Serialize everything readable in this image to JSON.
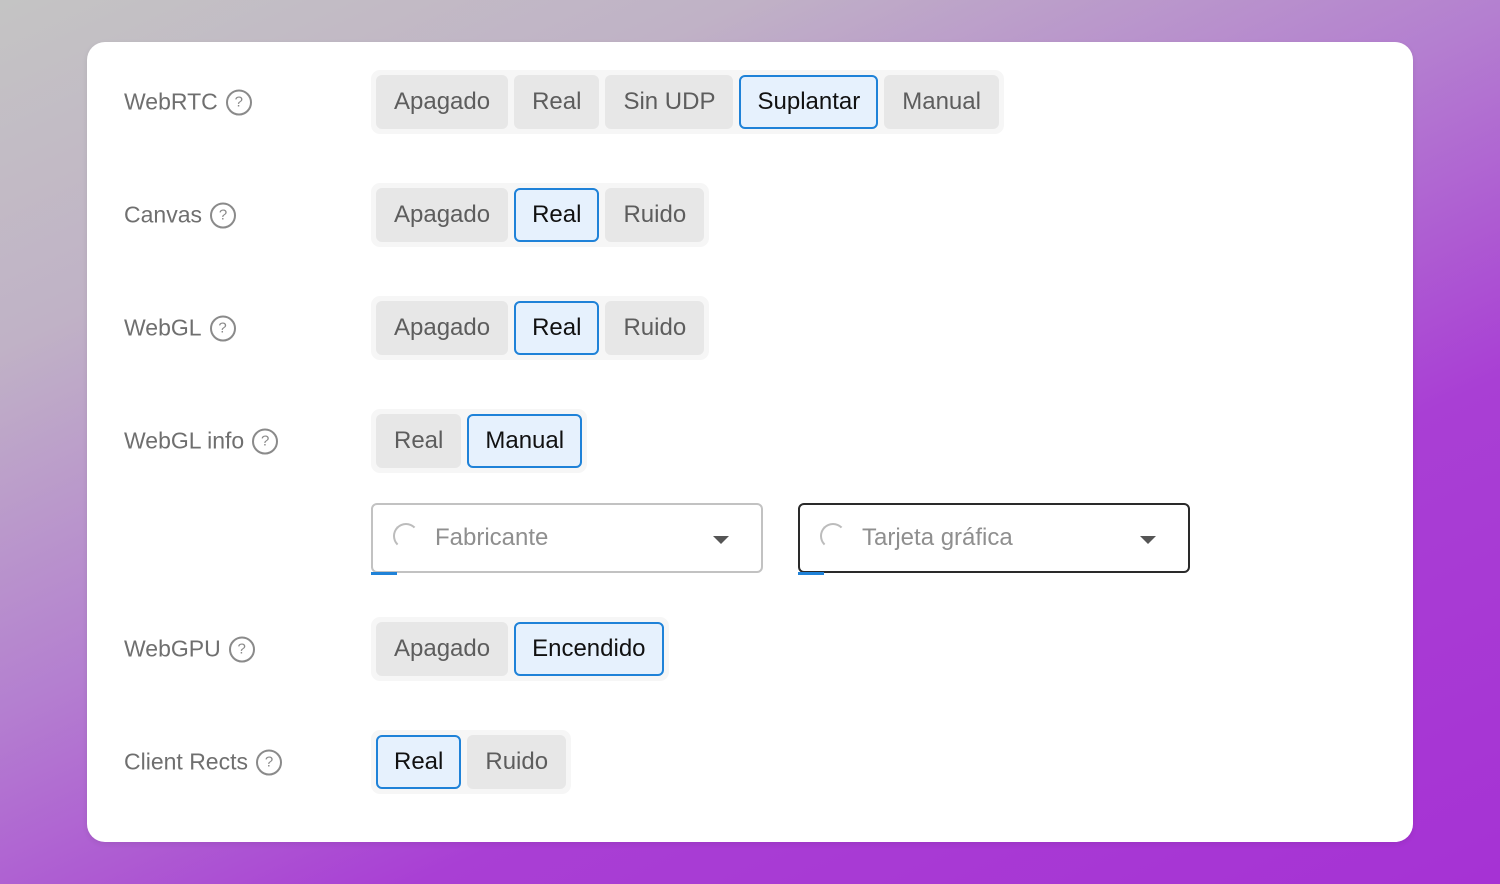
{
  "rows": [
    {
      "label": "WebRTC",
      "options": [
        "Apagado",
        "Real",
        "Sin UDP",
        "Suplantar",
        "Manual"
      ],
      "selected": "Suplantar"
    },
    {
      "label": "Canvas",
      "options": [
        "Apagado",
        "Real",
        "Ruido"
      ],
      "selected": "Real"
    },
    {
      "label": "WebGL",
      "options": [
        "Apagado",
        "Real",
        "Ruido"
      ],
      "selected": "Real"
    },
    {
      "label": "WebGL info",
      "options": [
        "Real",
        "Manual"
      ],
      "selected": "Manual"
    },
    {
      "label": "WebGPU",
      "options": [
        "Apagado",
        "Encendido"
      ],
      "selected": "Encendido"
    },
    {
      "label": "Client Rects",
      "options": [
        "Real",
        "Ruido"
      ],
      "selected": "Real"
    }
  ],
  "webgl_info_fields": {
    "vendor_placeholder": "Fabricante",
    "renderer_placeholder": "Tarjeta gráfica"
  },
  "help_glyph": "?",
  "colors": {
    "accent": "#1f82d8",
    "active_bg": "#e6f1fd",
    "inactive_bg": "#e7e7e7"
  }
}
